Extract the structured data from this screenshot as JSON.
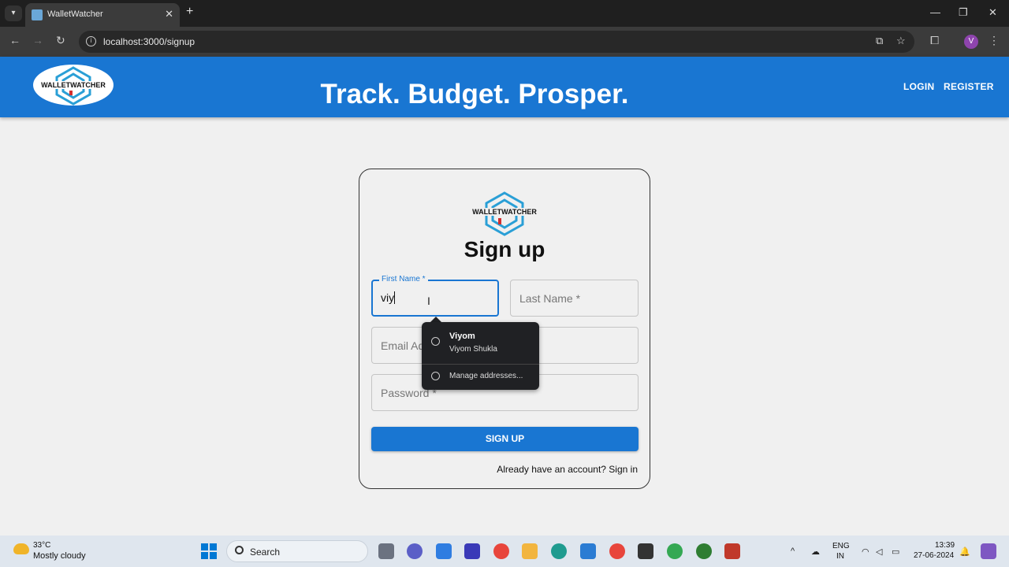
{
  "browser": {
    "tab_title": "WalletWatcher",
    "url": "localhost:3000/signup",
    "profile_initial": "V"
  },
  "header": {
    "tagline": "Track. Budget. Prosper.",
    "login_label": "LOGIN",
    "register_label": "REGISTER"
  },
  "form": {
    "title": "Sign up",
    "first_name_label": "First Name *",
    "first_name_value": "viy",
    "last_name_placeholder": "Last Name *",
    "email_placeholder": "Email Address *",
    "password_placeholder": "Password *",
    "submit_label": "SIGN UP",
    "signin_prompt": "Already have an account? Sign in"
  },
  "autofill": {
    "suggestion_name": "Viyom",
    "suggestion_full": "Viyom Shukla",
    "manage_label": "Manage addresses..."
  },
  "taskbar": {
    "temperature": "33°C",
    "weather": "Mostly cloudy",
    "search_label": "Search",
    "lang_top": "ENG",
    "lang_bottom": "IN",
    "time": "13:39",
    "date": "27-06-2024"
  },
  "colors": {
    "primary": "#1976d2",
    "page_bg": "#f0f0f0"
  }
}
